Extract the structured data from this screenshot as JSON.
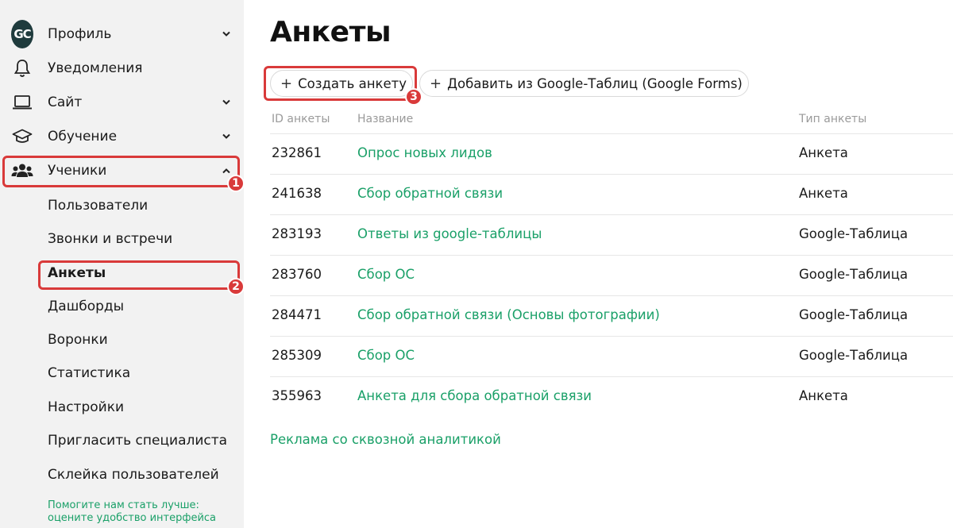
{
  "sidebar": {
    "logo_text": "GC",
    "items": [
      {
        "label": "Профиль",
        "icon": "gc-logo"
      },
      {
        "label": "Уведомления",
        "icon": "bell-icon"
      },
      {
        "label": "Сайт",
        "icon": "laptop-icon"
      },
      {
        "label": "Обучение",
        "icon": "graduation-cap-icon"
      },
      {
        "label": "Ученики",
        "icon": "users-icon"
      }
    ],
    "sub_items": [
      "Пользователи",
      "Звонки и встречи",
      "Анкеты",
      "Дашборды",
      "Воронки",
      "Статистика",
      "Настройки",
      "Пригласить специалиста",
      "Склейка пользователей"
    ],
    "active_sub_item": "Анкеты",
    "feedback_line1": "Помогите нам стать лучше:",
    "feedback_line2": "оцените удобство интерфейса"
  },
  "annotations": {
    "badge1": "1",
    "badge2": "2",
    "badge3": "3",
    "color": "#d93a3a"
  },
  "main": {
    "title": "Анкеты",
    "create_button": "Создать анкету",
    "import_button": "Добавить из Google-Таблиц (Google Forms)",
    "columns": [
      "ID анкеты",
      "Название",
      "Тип анкеты"
    ],
    "rows": [
      {
        "id": "232861",
        "name": "Опрос новых лидов",
        "type": "Анкета"
      },
      {
        "id": "241638",
        "name": "Сбор обратной связи",
        "type": "Анкета"
      },
      {
        "id": "283193",
        "name": "Ответы из google-таблицы",
        "type": "Google-Таблица"
      },
      {
        "id": "283760",
        "name": "Сбор ОС",
        "type": "Google-Таблица"
      },
      {
        "id": "284471",
        "name": "Сбор обратной связи (Основы фотографии)",
        "type": "Google-Таблица"
      },
      {
        "id": "285309",
        "name": "Сбор ОС",
        "type": "Google-Таблица"
      },
      {
        "id": "355963",
        "name": "Анкета для сбора обратной связи",
        "type": "Анкета"
      }
    ],
    "ads_link": "Реклама со сквозной аналитикой"
  },
  "colors": {
    "accent": "#1aa068",
    "sidebar_bg": "#f2f2f2",
    "highlight": "#d93a3a"
  }
}
